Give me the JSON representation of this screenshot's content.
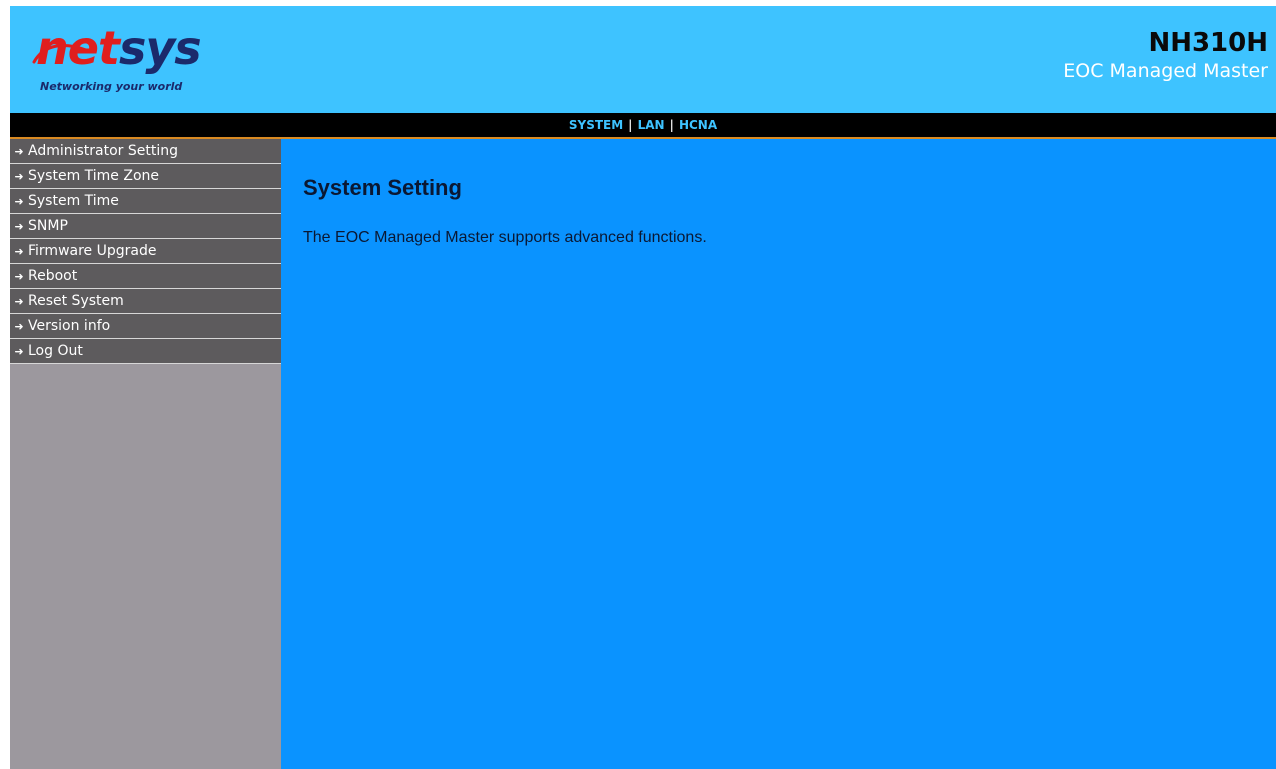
{
  "brand": {
    "logo_prefix": "net",
    "logo_suffix": "sys",
    "tagline": "Networking your world"
  },
  "model": {
    "name": "NH310H",
    "subtitle": "EOC Managed Master"
  },
  "nav": {
    "items": [
      "SYSTEM",
      "LAN",
      "HCNA"
    ],
    "separator": "|"
  },
  "sidebar": {
    "items": [
      {
        "label": "Administrator Setting"
      },
      {
        "label": "System Time Zone"
      },
      {
        "label": "System Time"
      },
      {
        "label": "SNMP"
      },
      {
        "label": "Firmware Upgrade"
      },
      {
        "label": "Reboot"
      },
      {
        "label": "Reset System"
      },
      {
        "label": "Version info"
      },
      {
        "label": "Log Out"
      }
    ],
    "arrow_icon": "arrow-right-icon"
  },
  "main": {
    "title": "System Setting",
    "description": "The EOC Managed Master supports advanced functions."
  },
  "colors": {
    "header_bg": "#3ec3ff",
    "nav_bg": "#000000",
    "nav_link": "#3ec3ff",
    "nav_border": "#d98a22",
    "sidebar_bg": "#9c989e",
    "sidebar_item_bg": "#5d5b5d",
    "content_bg": "#0a93ff",
    "logo_red": "#e01e1e",
    "logo_dark": "#1b2a6b"
  }
}
